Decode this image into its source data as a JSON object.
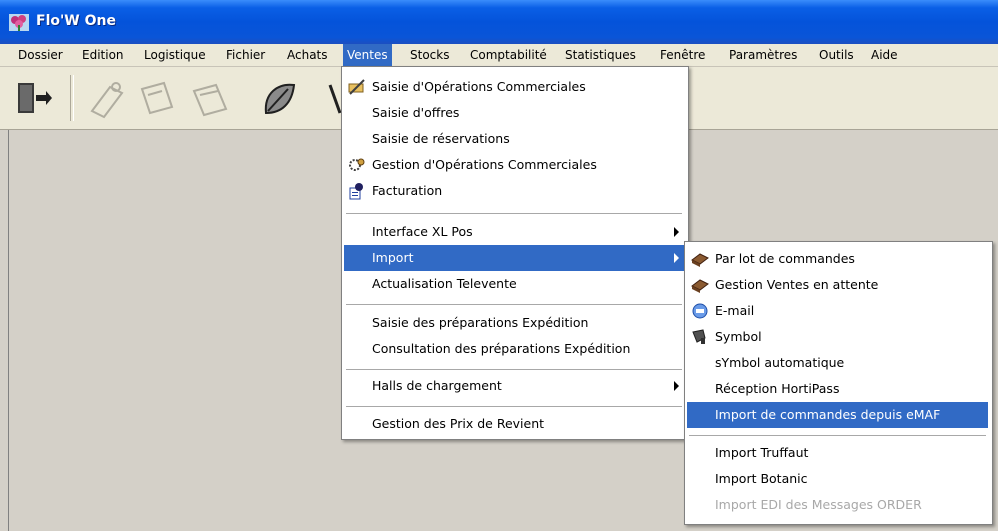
{
  "window": {
    "title": "Flo'W One"
  },
  "menubar": [
    {
      "label": "Dossier"
    },
    {
      "label": "Edition"
    },
    {
      "label": "Logistique"
    },
    {
      "label": "Fichier"
    },
    {
      "label": "Achats"
    },
    {
      "label": "Ventes"
    },
    {
      "label": "Stocks"
    },
    {
      "label": "Comptabilité"
    },
    {
      "label": "Statistiques"
    },
    {
      "label": "Fenêtre"
    },
    {
      "label": "Paramètres"
    },
    {
      "label": "Outils"
    },
    {
      "label": "Aide"
    }
  ],
  "ventes_menu": [
    {
      "label": "Saisie d'Opérations Commerciales",
      "icon": "pen-scroll-icon"
    },
    {
      "label": "Saisie d'offres"
    },
    {
      "label": "Saisie de réservations"
    },
    {
      "label": "Gestion d'Opérations Commerciales",
      "icon": "gear-wheels-icon"
    },
    {
      "label": "Facturation",
      "icon": "invoice-icon"
    },
    {
      "label": "Interface XL Pos"
    },
    {
      "label": "Import"
    },
    {
      "label": "Actualisation Televente"
    },
    {
      "label": "Saisie des préparations Expédition"
    },
    {
      "label": "Consultation des préparations Expédition"
    },
    {
      "label": "Halls de chargement"
    },
    {
      "label": "Gestion des Prix de Revient"
    }
  ],
  "import_menu": [
    {
      "label": "Par lot de commandes",
      "icon": "box-icon"
    },
    {
      "label": "Gestion Ventes en attente",
      "icon": "box-icon"
    },
    {
      "label": "E-mail",
      "icon": "email-icon"
    },
    {
      "label": "Symbol",
      "icon": "scanner-icon"
    },
    {
      "label": "sYmbol automatique"
    },
    {
      "label": "Réception HortiPass"
    },
    {
      "label": "Import de commandes depuis eMAF"
    },
    {
      "label": "Import Truffaut"
    },
    {
      "label": "Import Botanic"
    },
    {
      "label": "Import EDI des Messages ORDER"
    }
  ],
  "colors": {
    "titlebar": "#0453da",
    "highlight": "#316ac5",
    "menubar": "#ece9d8",
    "workspace": "#d4d0c8"
  }
}
